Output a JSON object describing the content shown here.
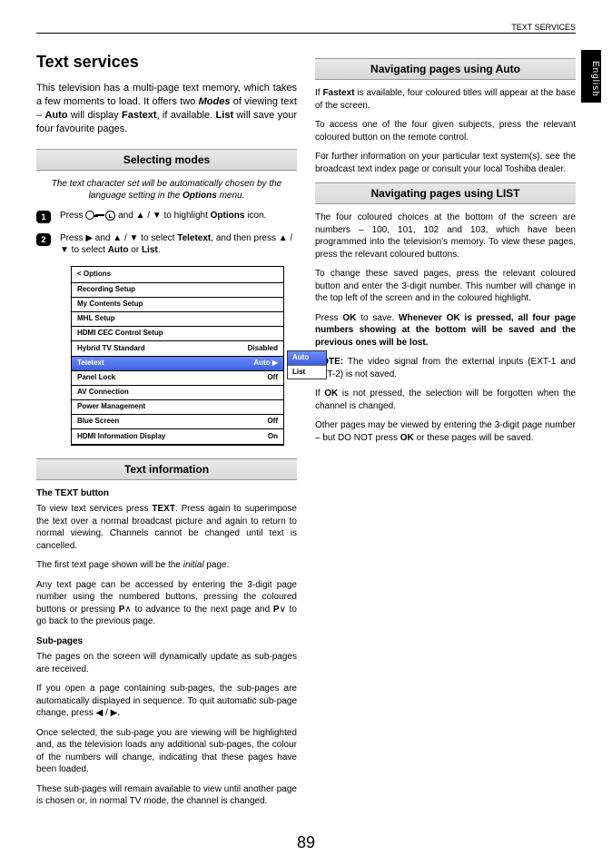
{
  "header": {
    "section": "TEXT SERVICES",
    "language_tab": "English"
  },
  "title": "Text services",
  "intro": "This television has a multi-page text memory, which takes a few moments to load. It offers two Modes of viewing text – Auto will display Fastext, if available. List will save your four favourite pages.",
  "selecting_modes": {
    "heading": "Selecting modes",
    "note": "The text character set will be automatically chosen by the language setting in the Options menu.",
    "step1_pre": "Press ",
    "step1_mid": " and ▲ / ▼ to highlight ",
    "step1_bold": "Options",
    "step1_post": " icon.",
    "step2_pre": "Press ▶ and ▲ / ▼ to select ",
    "step2_bold1": "Teletext",
    "step2_mid": ", and then press ▲ / ▼ to select ",
    "step2_bold2": "Auto",
    "step2_or": " or ",
    "step2_bold3": "List",
    "step2_post": "."
  },
  "menu": {
    "title": "< Options",
    "rows": [
      {
        "label": "Recording Setup",
        "value": ""
      },
      {
        "label": "My Contents Setup",
        "value": ""
      },
      {
        "label": "MHL Setup",
        "value": ""
      },
      {
        "label": "HDMI CEC Control Setup",
        "value": ""
      },
      {
        "label": "Hybrid TV Standard",
        "value": "Disabled"
      },
      {
        "label": "Teletext",
        "value": "Auto ▶",
        "selected": true
      },
      {
        "label": "Panel Lock",
        "value": "Off"
      },
      {
        "label": "AV Connection",
        "value": ""
      },
      {
        "label": "Power Management",
        "value": ""
      },
      {
        "label": "Blue Screen",
        "value": "Off"
      },
      {
        "label": "HDMI Information Display",
        "value": "On"
      }
    ],
    "popup": [
      "Auto",
      "List"
    ]
  },
  "text_info": {
    "heading": "Text information",
    "sub1": "The TEXT button",
    "p1": "To view text services press TEXT. Press again to superimpose the text over a normal broadcast picture and again to return to normal viewing. Channels cannot be changed until text is cancelled.",
    "p2": "The first text page shown will be the initial page.",
    "p3": "Any text page can be accessed by entering the 3-digit page number using the numbered buttons, pressing the coloured buttons or pressing P∧ to advance to the next page and P∨ to go back to the previous page.",
    "sub2": "Sub-pages",
    "p4": "The pages on the screen will dynamically update as sub-pages are received.",
    "p5": "If you open a page containing sub-pages, the sub-pages are automatically displayed in sequence. To quit automatic sub-page change, press ◀ / ▶.",
    "p6": "Once selected, the sub-page you are viewing will be highlighted and, as the television loads any additional sub-pages, the colour of the numbers will change, indicating that these pages have been loaded.",
    "p7": "These sub-pages will remain available to view until another page is chosen or, in normal TV mode, the channel is changed."
  },
  "nav_auto": {
    "heading": "Navigating pages using Auto",
    "p1": "If Fastext is available, four coloured titles will appear at the base of the screen.",
    "p2": "To access one of the four given subjects, press the relevant coloured button on the remote control.",
    "p3": "For further information on your particular text system(s), see the broadcast text index page or consult your local Toshiba dealer."
  },
  "nav_list": {
    "heading": "Navigating pages using LIST",
    "p1": "The four coloured choices at the bottom of the screen are numbers – 100, 101, 102 and 103, which have been programmed into the television's memory. To view these pages, press the relevant coloured buttons.",
    "p2": "To change these saved pages, press the relevant coloured button and enter the 3-digit number. This number will change in the top left of the screen and in the coloured highlight.",
    "p3a": "Press ",
    "p3b": "OK",
    "p3c": " to save. ",
    "p3bold": "Whenever OK is pressed, all four page numbers showing at the bottom will be saved and the previous ones will be lost.",
    "p4a": "NOTE:",
    "p4b": " The video signal from the external inputs (EXT-1 and EXT-2) is not saved.",
    "p5": "If OK is not pressed, the selection will be forgotten when the channel is changed.",
    "p6": "Other pages may be viewed by entering the 3-digit page number – but DO NOT press OK or these pages will be saved."
  },
  "page_number": "89"
}
